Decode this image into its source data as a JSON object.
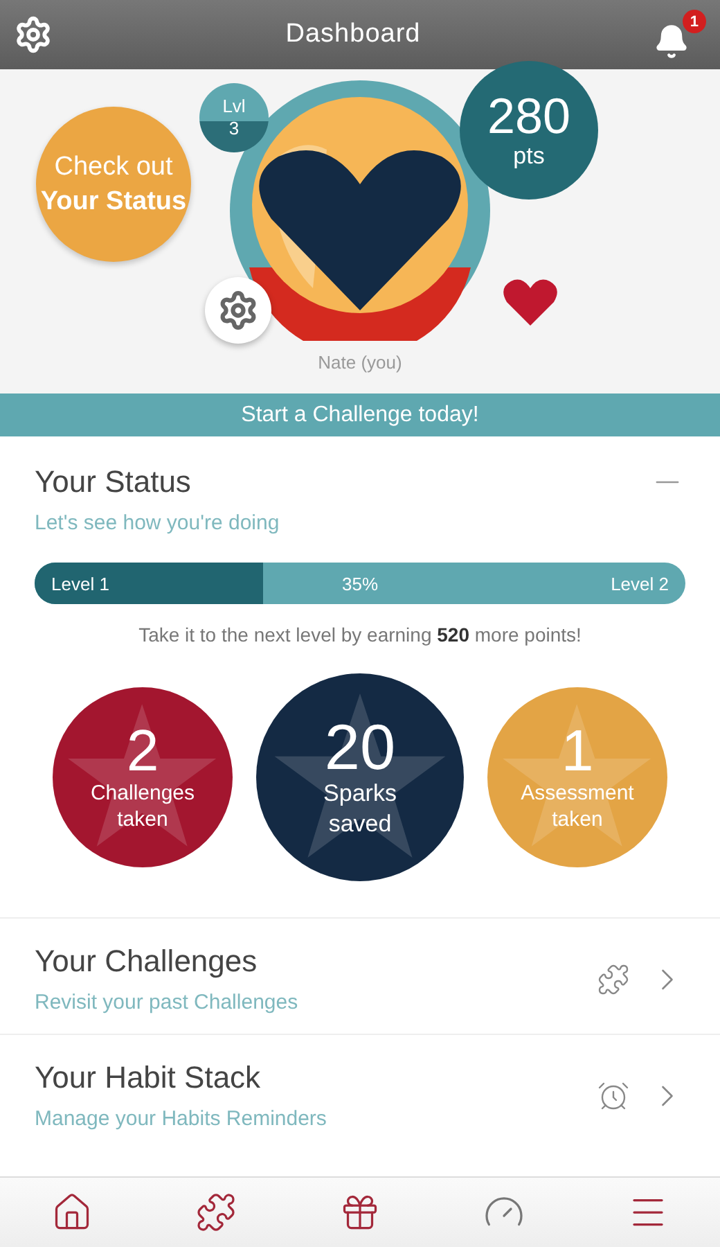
{
  "header": {
    "title": "Dashboard",
    "notification_count": "1"
  },
  "hero": {
    "status_prompt": "Check out **Your Status**",
    "level_label": "Lvl",
    "level_value": "3",
    "points": "280",
    "points_unit": "pts",
    "user_name": "Nate (you)"
  },
  "banner": "Start a Challenge today!",
  "status": {
    "title": "Your Status",
    "subtitle": "Let's see how you're doing",
    "progress": {
      "start_label": "Level 1",
      "percent": "35%",
      "end_label": "Level 2",
      "level": 0.35
    },
    "hint": "Take it to the next level by earning **520** more points!"
  },
  "stats": [
    {
      "value": "2",
      "label": "Challenges taken",
      "color": "#a3162f"
    },
    {
      "value": "20",
      "label": "Sparks saved",
      "color": "#142a44"
    },
    {
      "value": "1",
      "label": "Assessment taken",
      "color": "#e3a445"
    }
  ],
  "links": [
    {
      "title": "Your Challenges",
      "subtitle": "Revisit your past Challenges",
      "kind": "puzzle"
    },
    {
      "title": "Your Habit Stack",
      "subtitle": "Manage your Habits Reminders",
      "kind": "alarm"
    }
  ],
  "nav": [
    {
      "kind": "home"
    },
    {
      "kind": "puzzle"
    },
    {
      "kind": "gift"
    },
    {
      "kind": "gauge"
    },
    {
      "kind": "menu"
    }
  ]
}
